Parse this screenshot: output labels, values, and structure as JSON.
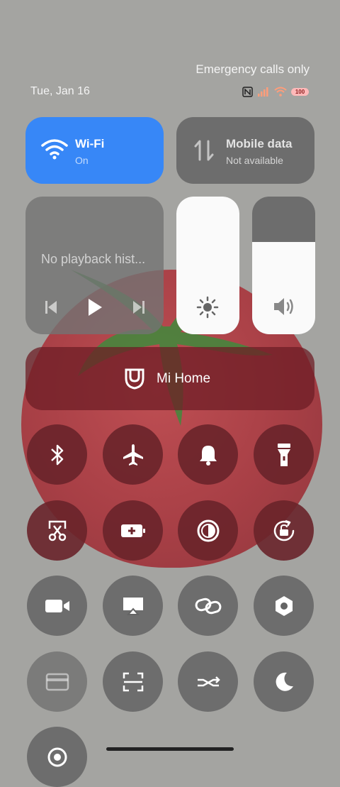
{
  "status": {
    "top_text": "Emergency calls only",
    "date": "Tue, Jan 16",
    "battery": "100"
  },
  "wifi": {
    "title": "Wi-Fi",
    "sub": "On",
    "icon": "wifi-icon"
  },
  "mobile": {
    "title": "Mobile data",
    "sub": "Not available",
    "icon": "mobile-data-icon"
  },
  "media": {
    "text": "No playback hist..."
  },
  "sliders": {
    "brightness_level": 1.0,
    "volume_level": 0.67
  },
  "mihome": {
    "label": "Mi Home"
  },
  "toggles": [
    "bluetooth-icon",
    "airplane-icon",
    "bell-icon",
    "flashlight-icon",
    "screenshot-icon",
    "battery-saver-icon",
    "reading-mode-icon",
    "rotation-lock-icon",
    "video-icon",
    "cast-icon",
    "link-icon",
    "settings-icon",
    "card-icon",
    "scanner-icon",
    "sync-icon",
    "moon-icon",
    "location-icon"
  ]
}
